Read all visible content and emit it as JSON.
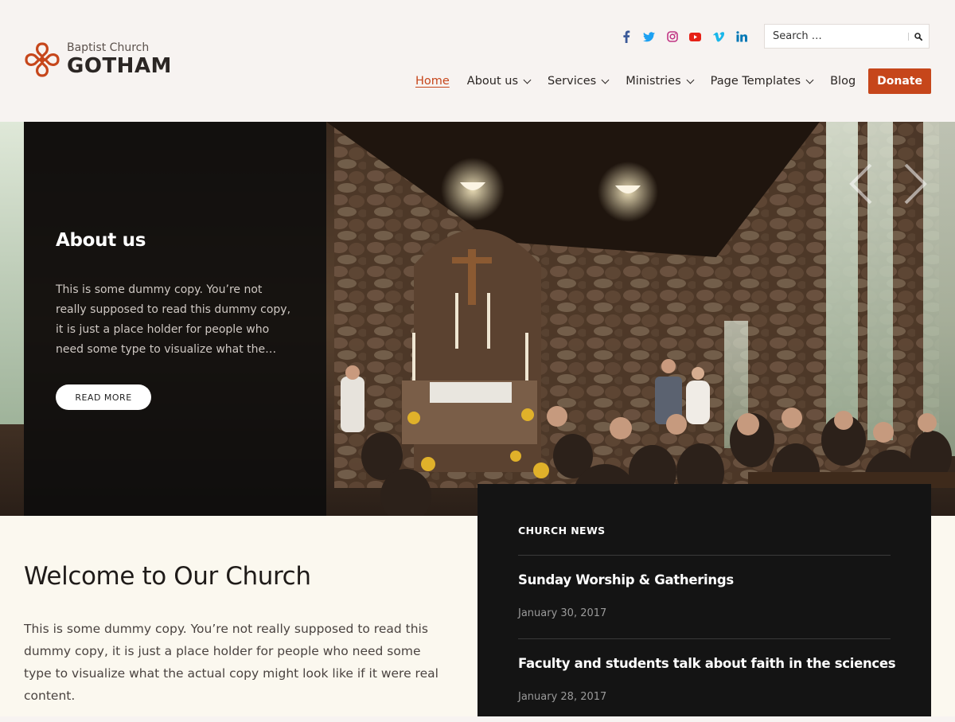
{
  "brand": {
    "tagline": "Baptist Church",
    "title": "GOTHAM",
    "accent_color": "#c6461b"
  },
  "social": [
    {
      "icon": "facebook-icon",
      "color": "#3b5998"
    },
    {
      "icon": "twitter-icon",
      "color": "#1da1f2"
    },
    {
      "icon": "instagram-icon",
      "color": "#c13584"
    },
    {
      "icon": "youtube-icon",
      "color": "#e62117"
    },
    {
      "icon": "vimeo-icon",
      "color": "#1ab7ea"
    },
    {
      "icon": "linkedin-icon",
      "color": "#0077b5"
    }
  ],
  "search": {
    "placeholder": "Search …",
    "icon": "search-icon"
  },
  "nav": {
    "items": [
      {
        "label": "Home",
        "active": true,
        "has_dropdown": false
      },
      {
        "label": "About us",
        "active": false,
        "has_dropdown": true
      },
      {
        "label": "Services",
        "active": false,
        "has_dropdown": true
      },
      {
        "label": "Ministries",
        "active": false,
        "has_dropdown": true
      },
      {
        "label": "Page Templates",
        "active": false,
        "has_dropdown": true
      },
      {
        "label": "Blog",
        "active": false,
        "has_dropdown": false
      }
    ],
    "donate_label": "Donate"
  },
  "hero": {
    "title": "About us",
    "text": "This is some dummy copy. You’re not really supposed to read this dummy copy, it is just a place holder for people who need some type to visualize what the…",
    "button_label": "READ MORE",
    "prev_icon": "chevron-left-icon",
    "next_icon": "chevron-right-icon"
  },
  "welcome": {
    "title": "Welcome to Our Church",
    "text": "This is some dummy copy. You’re not really supposed to read this dummy copy, it is just a place holder for people who need some type to visualize what the actual copy might look like if it were real content."
  },
  "news": {
    "heading": "CHURCH NEWS",
    "items": [
      {
        "title": "Sunday Worship & Gatherings",
        "date": "January 30, 2017"
      },
      {
        "title": "Faculty and students talk about faith in the sciences",
        "date": "January 28, 2017"
      }
    ]
  }
}
